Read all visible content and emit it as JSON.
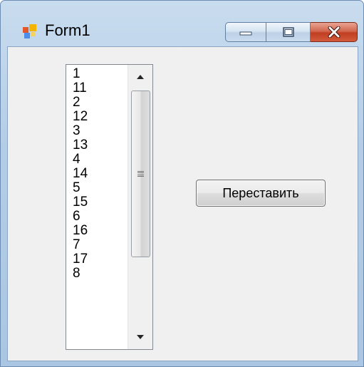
{
  "window": {
    "title": "Form1",
    "icon": "winforms-app-icon",
    "controls": {
      "minimize_icon": "minimize-icon",
      "maximize_icon": "maximize-icon",
      "close_icon": "close-icon"
    },
    "colors": {
      "frame": "#b4cde6",
      "client": "#f0f0f0",
      "close_button": "#c13e22"
    }
  },
  "listbox": {
    "items": [
      "1",
      "11",
      "2",
      "12",
      "3",
      "13",
      "4",
      "14",
      "5",
      "15",
      "6",
      "16",
      "7",
      "17",
      "8"
    ],
    "scrollbar": {
      "up_icon": "scroll-up-arrow-icon",
      "down_icon": "scroll-down-arrow-icon",
      "thumb_icon": "scroll-thumb-grip-icon"
    }
  },
  "button": {
    "label": "Переставить"
  }
}
